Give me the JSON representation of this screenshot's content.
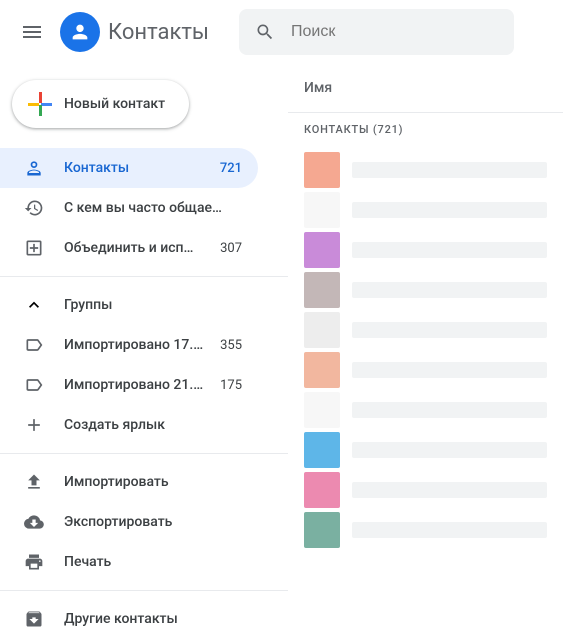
{
  "header": {
    "app_title": "Контакты",
    "search_placeholder": "Поиск"
  },
  "sidebar": {
    "new_contact_label": "Новый контакт",
    "items": [
      {
        "label": "Контакты",
        "count": "721"
      },
      {
        "label": "С кем вы часто общае…",
        "count": ""
      },
      {
        "label": "Объединить и исп…",
        "count": "307"
      }
    ],
    "groups_label": "Группы",
    "labels": [
      {
        "label": "Импортировано 17.…",
        "count": "355"
      },
      {
        "label": "Импортировано 21.…",
        "count": "175"
      }
    ],
    "create_label": "Создать ярлык",
    "actions": {
      "import": "Импортировать",
      "export": "Экспортировать",
      "print": "Печать"
    },
    "other_contacts": "Другие контакты"
  },
  "main": {
    "column_name": "Имя",
    "group_header": "КОНТАКТЫ (721)",
    "contacts": [
      {
        "color": "#f5a891"
      },
      {
        "color": "#f7f7f7"
      },
      {
        "color": "#c98bd9"
      },
      {
        "color": "#c3b7b7"
      },
      {
        "color": "#ededed"
      },
      {
        "color": "#f2b79f"
      },
      {
        "color": "#f7f7f7"
      },
      {
        "color": "#5eb6e8"
      },
      {
        "color": "#ec8ab0"
      },
      {
        "color": "#7ab0a1"
      }
    ]
  }
}
